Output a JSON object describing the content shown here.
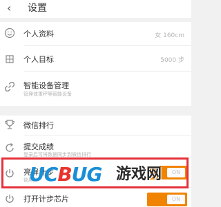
{
  "header": {
    "back_icon": "chevron-left-icon",
    "title": "设置"
  },
  "items": [
    {
      "icon": "smile-icon",
      "label": "个人资料",
      "value": "女 160cm"
    },
    {
      "icon": "target-icon",
      "label": "个人目标",
      "value": "5000 步"
    },
    {
      "icon": "link-icon",
      "label": "智能设备管理",
      "sub": "管理体重秤等智能设备"
    },
    {
      "icon": "trophy-icon",
      "label": "微信排行"
    },
    {
      "icon": "refresh-icon",
      "label": "提交成绩",
      "sub": "登录后可将数据同步到微信排行"
    },
    {
      "icon": "power-icon",
      "label": "亮屏计步",
      "sub": "锁屏后",
      "toggle": "ON"
    },
    {
      "icon": "power-icon",
      "label": "打开计步芯片",
      "toggle": "ON"
    }
  ],
  "watermark": {
    "left_logo": "UCBUG",
    "right_text": "游戏网"
  },
  "colors": {
    "accent": "#f08300",
    "highlight_border": "#e5303a",
    "logo_blue": "#1a8fd8",
    "logo_red": "#e8342c"
  }
}
